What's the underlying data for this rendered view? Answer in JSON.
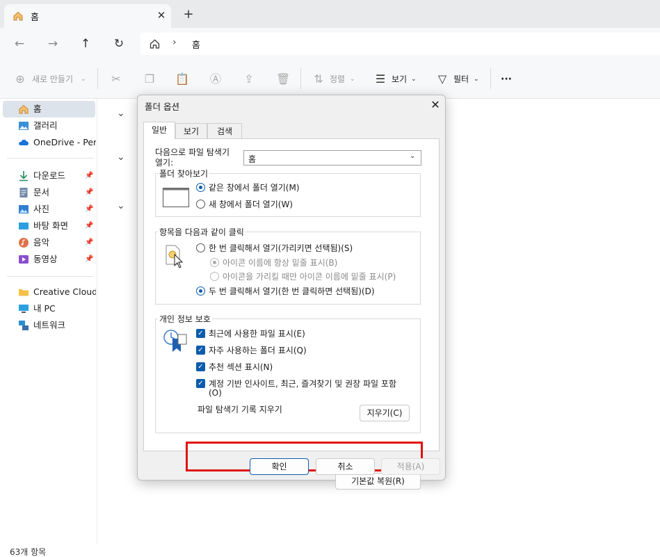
{
  "tab": {
    "title": "홈",
    "close": "✕",
    "new_tab": "+"
  },
  "nav": {
    "back": "←",
    "forward": "→",
    "up": "↑",
    "refresh": "↻"
  },
  "address": {
    "separator": "›",
    "crumb": "홈"
  },
  "toolbar": {
    "new_label": "새로 만들기",
    "sort_label": "정렬",
    "view_label": "보기",
    "filter_label": "필터",
    "more_label": "···"
  },
  "sidebar": {
    "home": "홈",
    "gallery": "갤러리",
    "onedrive": "OneDrive - Perso",
    "downloads": "다운로드",
    "documents": "문서",
    "pictures": "사진",
    "desktop": "바탕 화면",
    "music": "음악",
    "videos": "동영상",
    "creative_cloud": "Creative Cloud F",
    "this_pc": "내 PC",
    "network": "네트워크"
  },
  "status": {
    "item_count": "63개 항목"
  },
  "dialog": {
    "title": "폴더 옵션",
    "tabs": {
      "general": "일반",
      "view": "보기",
      "search": "검색"
    },
    "open_explorer_label_1": "다음으로 파일 탐색기",
    "open_explorer_label_2": "열기:",
    "open_explorer_value": "홈",
    "browse_group": "폴더 찾아보기",
    "browse_same": "같은 창에서 폴더 열기(M)",
    "browse_new": "새 창에서 폴더 열기(W)",
    "click_group": "항목을 다음과 같이 클릭",
    "single_click": "한 번 클릭해서 열기(가리키면 선택됨)(S)",
    "underline_always": "아이콘 이름에 항상 밑줄 표시(B)",
    "underline_hover": "아이콘을 가리킬 때만 아이콘 이름에 밑줄 표시(P)",
    "double_click": "두 번 클릭해서 열기(한 번 클릭하면 선택됨)(D)",
    "privacy_group": "개인 정보 보호",
    "show_recent_files": "최근에 사용한 파일 표시(E)",
    "show_frequent_folders": "자주 사용하는 폴더 표시(Q)",
    "show_recommended": "추천 섹션 표시(N)",
    "include_account_1": "계정 기반 인사이트, 최근, 즐겨찾기 및 권장 파일 포함",
    "include_account_2": "(O)",
    "clear_history_label": "파일 탐색기 기록 지우기",
    "clear_button": "지우기(C)",
    "restore_defaults": "기본값 복원(R)",
    "ok": "확인",
    "cancel": "취소",
    "apply": "적용(A)"
  },
  "colors": {
    "accent": "#0b5cad",
    "highlight": "#e01010"
  }
}
